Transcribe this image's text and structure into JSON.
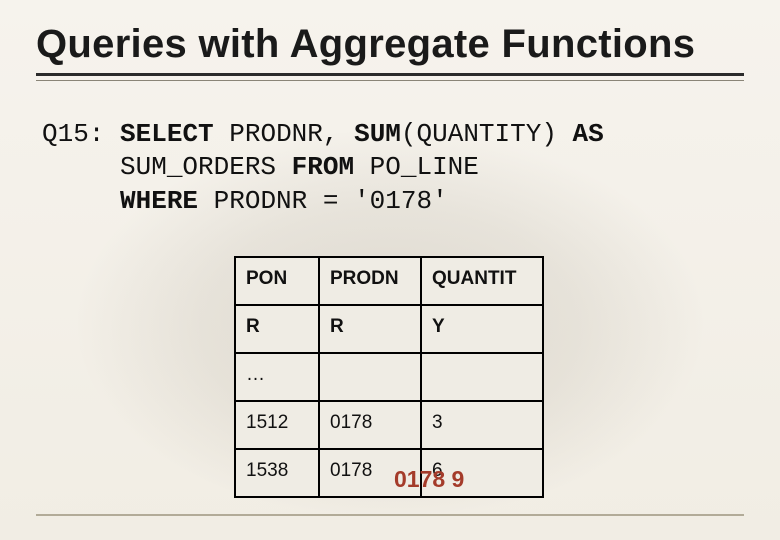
{
  "title": "Queries with Aggregate Functions",
  "query": {
    "label": "Q15:",
    "select_kw": "SELECT",
    "select_cols": " PRODNR, ",
    "sum_kw": "SUM",
    "sum_arg": "(QUANTITY) ",
    "as_kw": "AS",
    "alias_line": "     SUM_ORDERS ",
    "from_kw": "FROM",
    "from_tbl": " PO_LINE",
    "where_pad": "     ",
    "where_kw": "WHERE",
    "where_pred": " PRODNR = '0178'"
  },
  "table": {
    "headers": {
      "c1a": "PON",
      "c2a": "PRODN",
      "c3a": "QUANTIT",
      "c1b": "R",
      "c2b": "R",
      "c3b": "Y"
    },
    "ellipsis": "…",
    "rows": [
      {
        "c1": "1512",
        "c2": "0178",
        "c3": "3"
      },
      {
        "c1": "1538",
        "c2": "0178",
        "c3": "6"
      }
    ]
  },
  "overlay_result": "0178  9"
}
